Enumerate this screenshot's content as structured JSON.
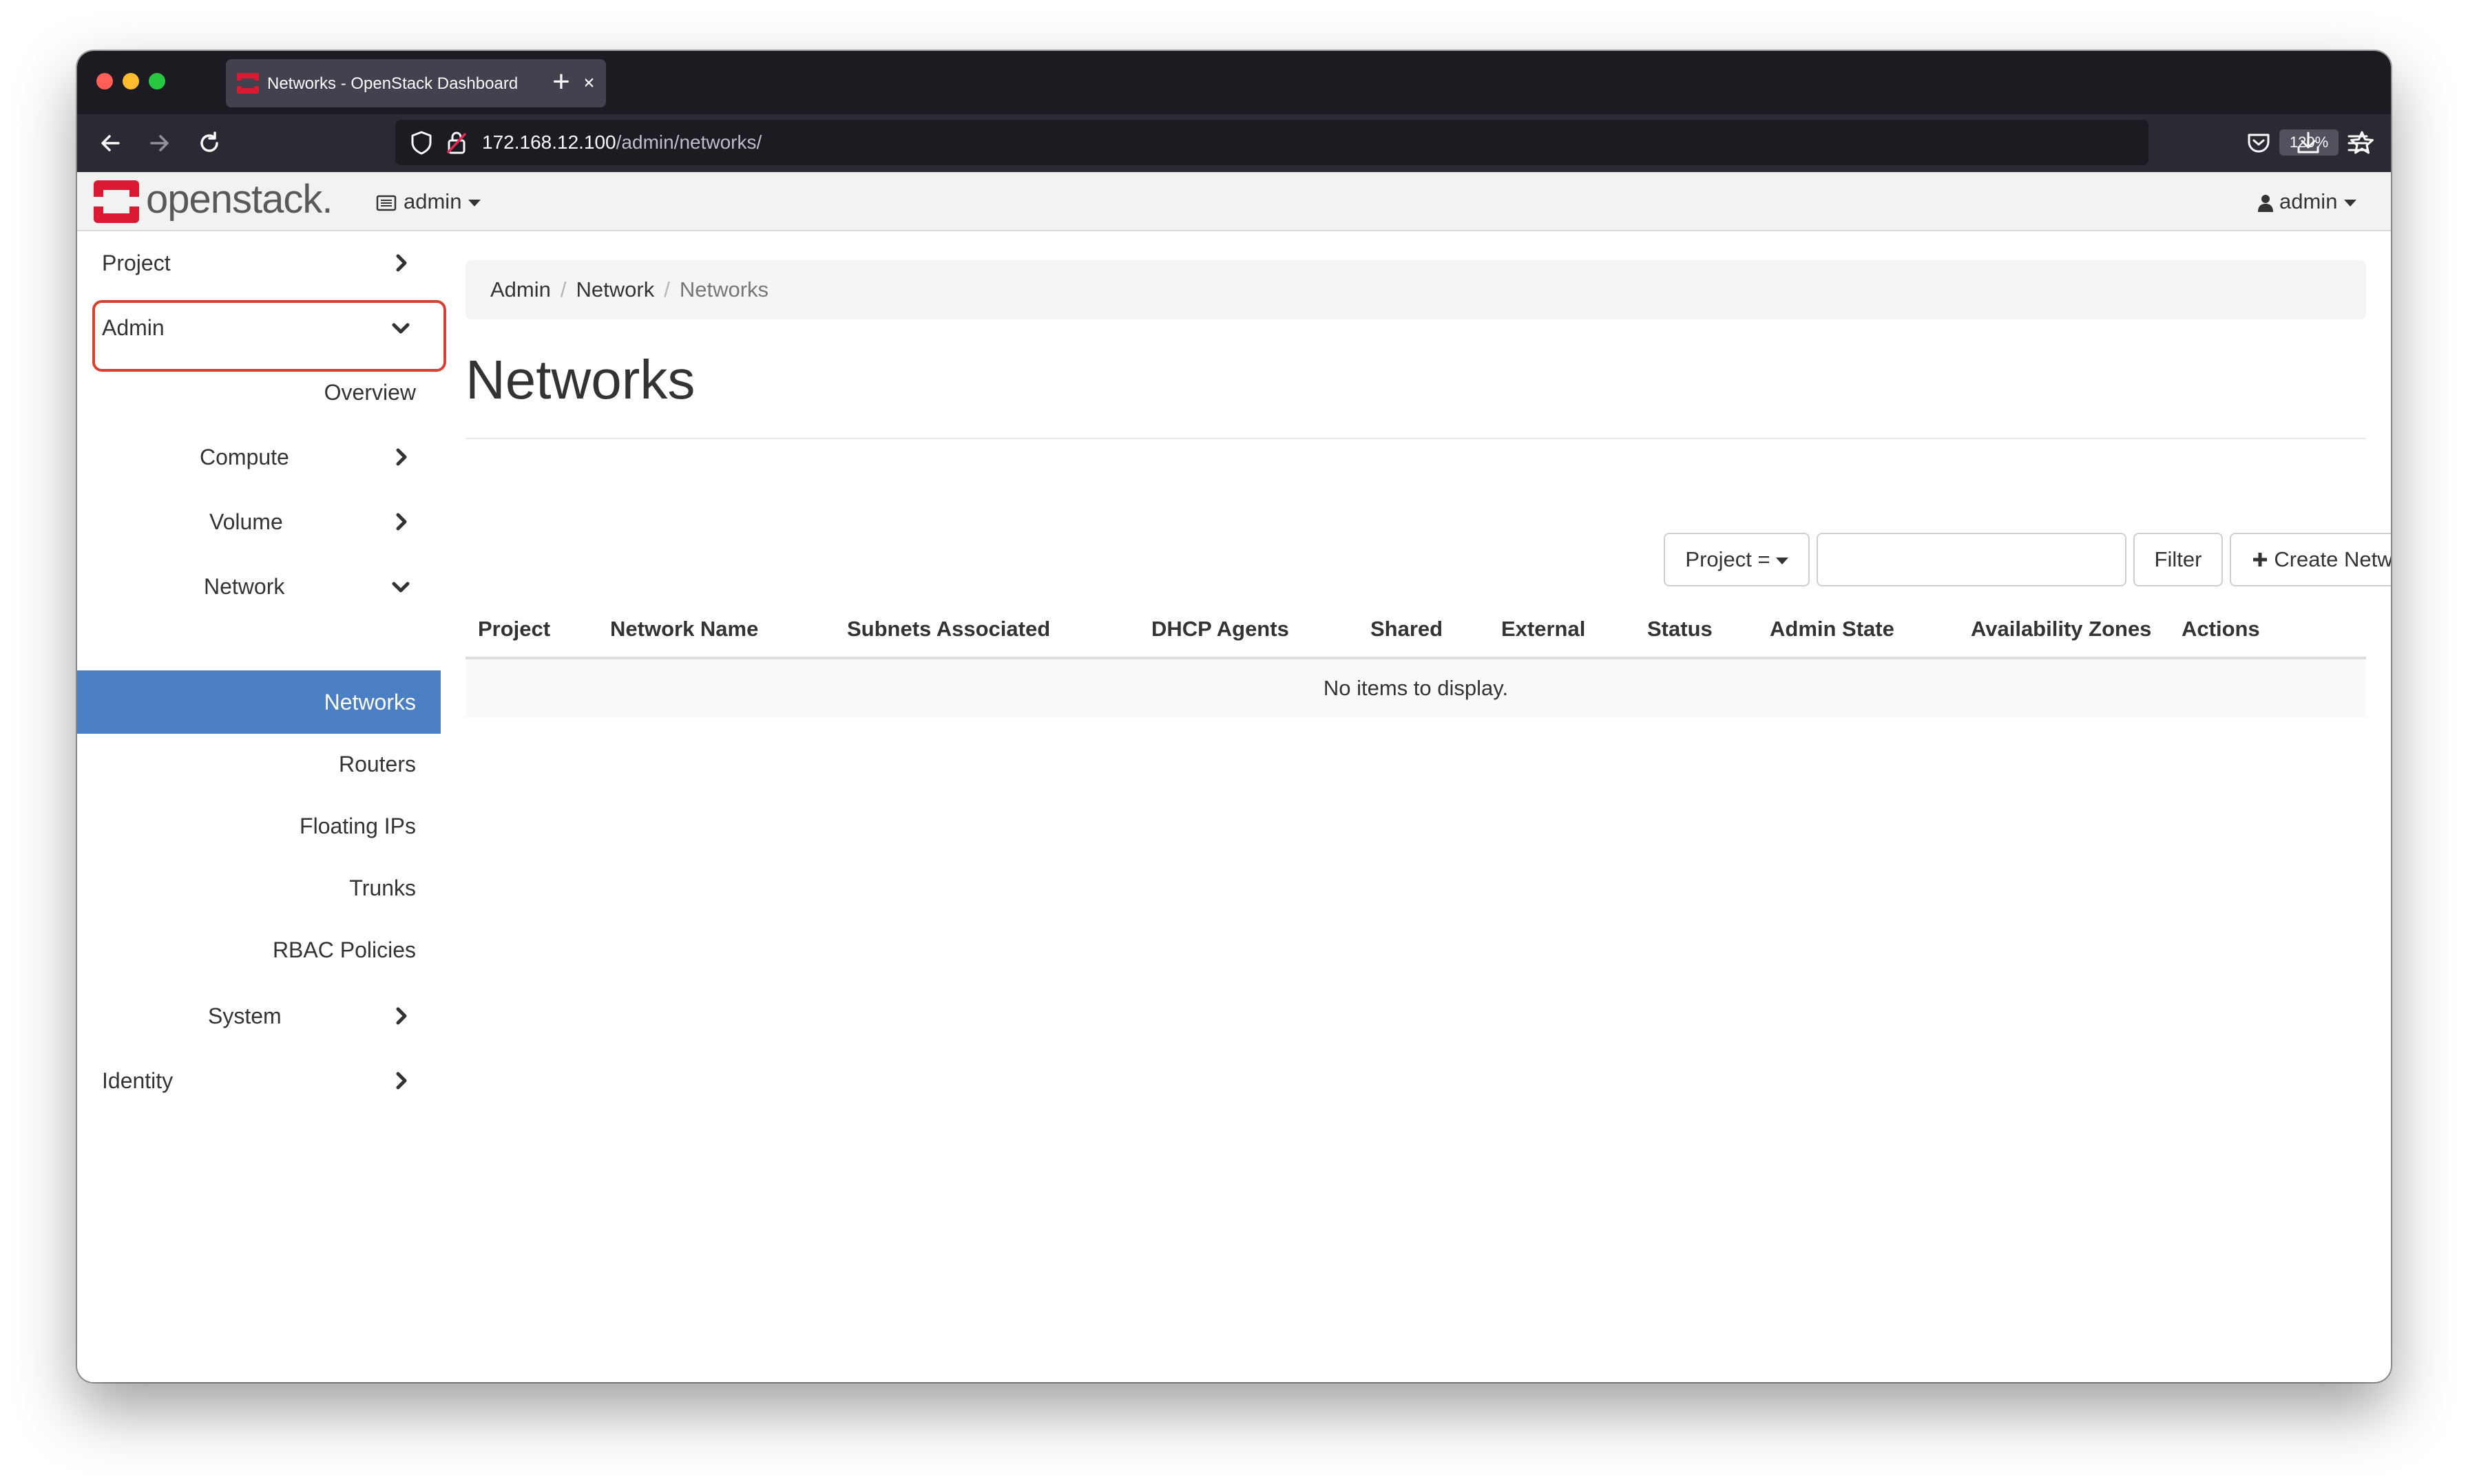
{
  "browser": {
    "tab_title": "Networks - OpenStack Dashboard",
    "new_tab_symbol": "+",
    "close_symbol": "×",
    "url_host": "172.168.12.100",
    "url_path": "/admin/networks/",
    "zoom": "120%",
    "icons": [
      "back-icon",
      "forward-icon",
      "reload-icon",
      "shield-icon",
      "lock-icon",
      "star-icon",
      "pocket-icon",
      "download-icon",
      "menu-icon"
    ]
  },
  "header": {
    "logo_text": "openstack.",
    "project_name": "admin",
    "user_name": "admin",
    "brand_color": "#da1a32"
  },
  "sidebar": {
    "project": "Project",
    "admin": "Admin",
    "overview": "Overview",
    "compute": "Compute",
    "volume": "Volume",
    "network": "Network",
    "networks": "Networks",
    "routers": "Routers",
    "floating_ips": "Floating IPs",
    "trunks": "Trunks",
    "rbac_policies": "RBAC Policies",
    "system": "System",
    "identity": "Identity",
    "active_color": "#4a7fc3",
    "highlight_color": "#d9402f"
  },
  "breadcrumb": {
    "admin": "Admin",
    "network": "Network",
    "current": "Networks",
    "separator": "/"
  },
  "page": {
    "title": "Networks"
  },
  "toolbar": {
    "filter_field": "Project =",
    "filter_value": "",
    "filter_button": "Filter",
    "create_button": "Create Network"
  },
  "table": {
    "headers": {
      "project": "Project",
      "network_name": "Network Name",
      "subnets": "Subnets Associated",
      "dhcp": "DHCP Agents",
      "shared": "Shared",
      "external": "External",
      "status": "Status",
      "admin_state": "Admin State",
      "zones": "Availability Zones",
      "actions": "Actions"
    },
    "empty_message": "No items to display."
  }
}
